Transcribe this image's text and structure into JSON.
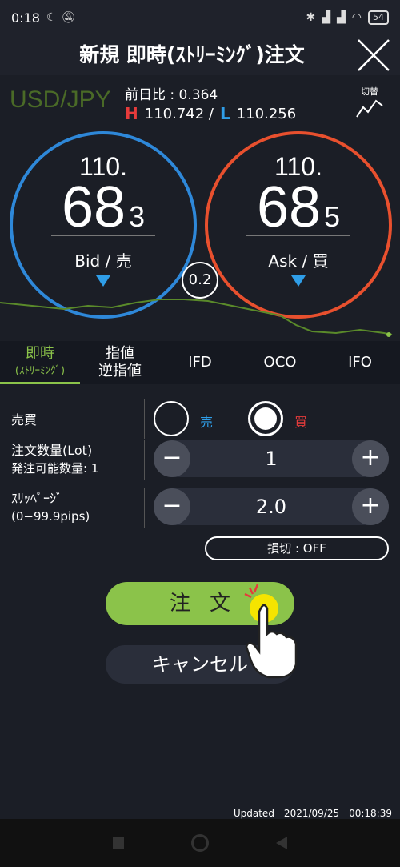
{
  "status_bar": {
    "time": "0:18",
    "battery": "54"
  },
  "header": {
    "title": "新規 即時(ｽﾄﾘｰﾐﾝｸﾞ)注文"
  },
  "quote": {
    "pair": "USD/JPY",
    "prev_label": "前日比 : 0.364",
    "high_label": "H",
    "high_value": "110.742 /",
    "low_label": "L",
    "low_value": "110.256",
    "switch_label": "切替"
  },
  "bid": {
    "top": "110.",
    "big": "68",
    "pip": "3",
    "label": "Bid / 売"
  },
  "ask": {
    "top": "110.",
    "big": "68",
    "pip": "5",
    "label": "Ask / 買"
  },
  "spread": "0.2",
  "tabs": [
    {
      "label": "即時",
      "sub": "(ｽﾄﾘｰﾐﾝｸﾞ)"
    },
    {
      "label": "指値",
      "sub": "逆指値"
    },
    {
      "label": "IFD"
    },
    {
      "label": "OCO"
    },
    {
      "label": "IFO"
    }
  ],
  "form": {
    "side_label": "売買",
    "sell_label": "売",
    "buy_label": "買",
    "qty_label": "注文数量(Lot)",
    "qty_sub": "発注可能数量: 1",
    "qty_value": "1",
    "slip_label": "ｽﾘｯﾍﾟｰｼﾞ",
    "slip_sub": "(0−99.9pips)",
    "slip_value": "2.0",
    "stoploss_label": "損切 : OFF"
  },
  "order_button": "注文",
  "cancel_button": "キャンセル",
  "updated": "Updated　2021/09/25　00:18:39",
  "colors": {
    "accent": "#8bc34a",
    "bid": "#2e88d9",
    "ask": "#e8502e",
    "sell": "#2f9ee8",
    "buy": "#e63b3b"
  }
}
